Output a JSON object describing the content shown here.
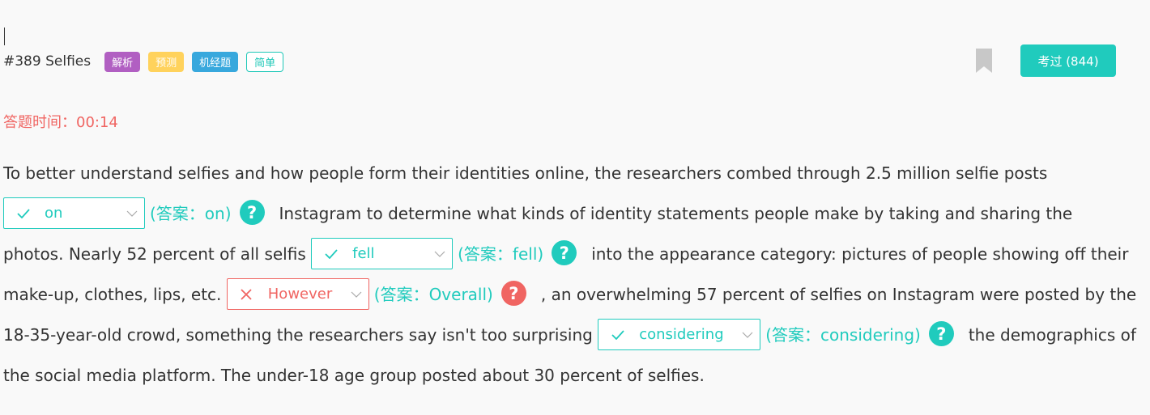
{
  "header": {
    "question_title": "#389 Selfies",
    "tags": [
      "解析",
      "预测",
      "机经题",
      "简单"
    ],
    "done_button": "考过 (844)"
  },
  "timer": "答题时间：00:14",
  "passage": {
    "text_1": "To better understand selfies and how people form their identities online, the researchers combed through 2.5 million selfie posts",
    "blank_1": {
      "selected": "on",
      "answer": "(答案：on)",
      "status": "correct"
    },
    "text_2": "Instagram to determine what kinds of identity statements people make by taking and sharing the photos. Nearly 52 percent of all selfis",
    "blank_2": {
      "selected": "fell",
      "answer": "(答案：fell)",
      "status": "correct"
    },
    "text_3": "into the appearance category: pictures of people showing off their make-up, clothes, lips, etc.",
    "blank_3": {
      "selected": "However",
      "answer": "(答案：Overall)",
      "status": "wrong"
    },
    "text_4": ", an overwhelming 57 percent of selfies on Instagram were posted by the 18-35-year-old crowd, something the researchers say isn't too surprising",
    "blank_4": {
      "selected": "considering",
      "answer": "(答案：considering)",
      "status": "correct"
    },
    "text_5": "the demographics of the social media platform. The under-18 age group posted about 30 percent of selfies."
  },
  "icons": {
    "help": "question-circle-icon",
    "correct": "check-icon",
    "wrong": "x-icon",
    "dropdown": "chevron-down-icon",
    "bookmark": "bookmark-icon"
  },
  "colors": {
    "accent": "#20cbbd",
    "error": "#f06562",
    "tag_purple": "#b15fc2",
    "tag_yellow": "#ffd25c",
    "tag_blue": "#38a8dd",
    "bookmark": "#c8c8c8"
  }
}
